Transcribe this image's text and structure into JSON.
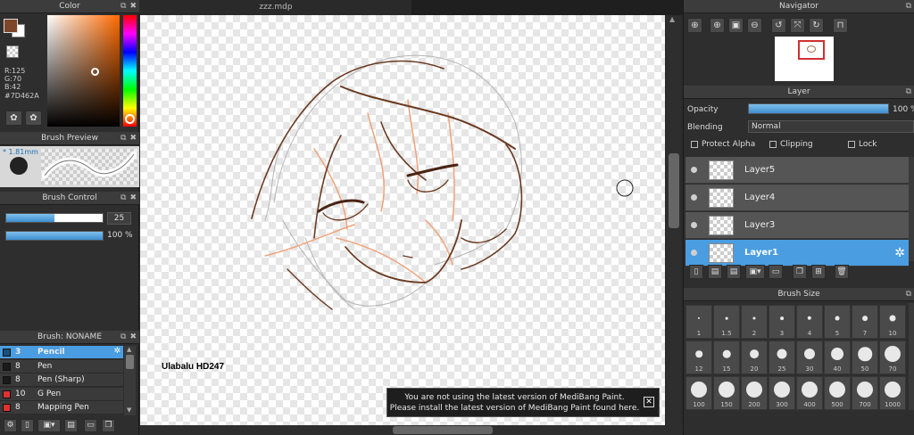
{
  "document_tab": "zzz.mdp",
  "color_panel": {
    "title": "Color",
    "r": "R:125",
    "g": "G:70",
    "b": "B:42",
    "hex": "#7D462A",
    "primary_color": "#7d462a",
    "secondary_color": "#ffffff"
  },
  "brush_preview": {
    "title": "Brush Preview",
    "size": "* 1.81mm"
  },
  "brush_control": {
    "title": "Brush Control",
    "size_value": "25",
    "opacity_value": "100 %",
    "size_fraction": 0.5,
    "opacity_fraction": 1.0
  },
  "brush_list": {
    "title": "Brush: NONAME",
    "items": [
      {
        "num": "3",
        "name": "Pencil",
        "color": "#1a4f7a",
        "selected": true
      },
      {
        "num": "8",
        "name": "Pen",
        "color": "#1a1a1a",
        "selected": false
      },
      {
        "num": "8",
        "name": "Pen (Sharp)",
        "color": "#1a1a1a",
        "selected": false
      },
      {
        "num": "10",
        "name": "G Pen",
        "color": "#e03030",
        "selected": false
      },
      {
        "num": "8",
        "name": "Mapping Pen",
        "color": "#e03030",
        "selected": false
      }
    ]
  },
  "canvas": {
    "watermark": "Ulabalu HD247",
    "notice_line1": "You are not using the latest version of MediBang Paint.",
    "notice_line2": "Please install the latest version of MediBang Paint found here."
  },
  "navigator": {
    "title": "Navigator"
  },
  "layer_panel": {
    "title": "Layer",
    "opacity_label": "Opacity",
    "opacity_value": "100 %",
    "opacity_fraction": 1.0,
    "blending_label": "Blending",
    "blending_value": "Normal",
    "protect_alpha": "Protect Alpha",
    "clipping": "Clipping",
    "lock": "Lock",
    "layers": [
      "Layer5",
      "Layer4",
      "Layer3",
      "Layer1"
    ],
    "selected_layer": "Layer1"
  },
  "brush_size": {
    "title": "Brush Size",
    "sizes": [
      "1",
      "1.5",
      "2",
      "3",
      "4",
      "5",
      "7",
      "10",
      "12",
      "15",
      "20",
      "25",
      "30",
      "40",
      "50",
      "70",
      "100",
      "150",
      "200",
      "300",
      "400",
      "500",
      "700",
      "1000"
    ]
  }
}
